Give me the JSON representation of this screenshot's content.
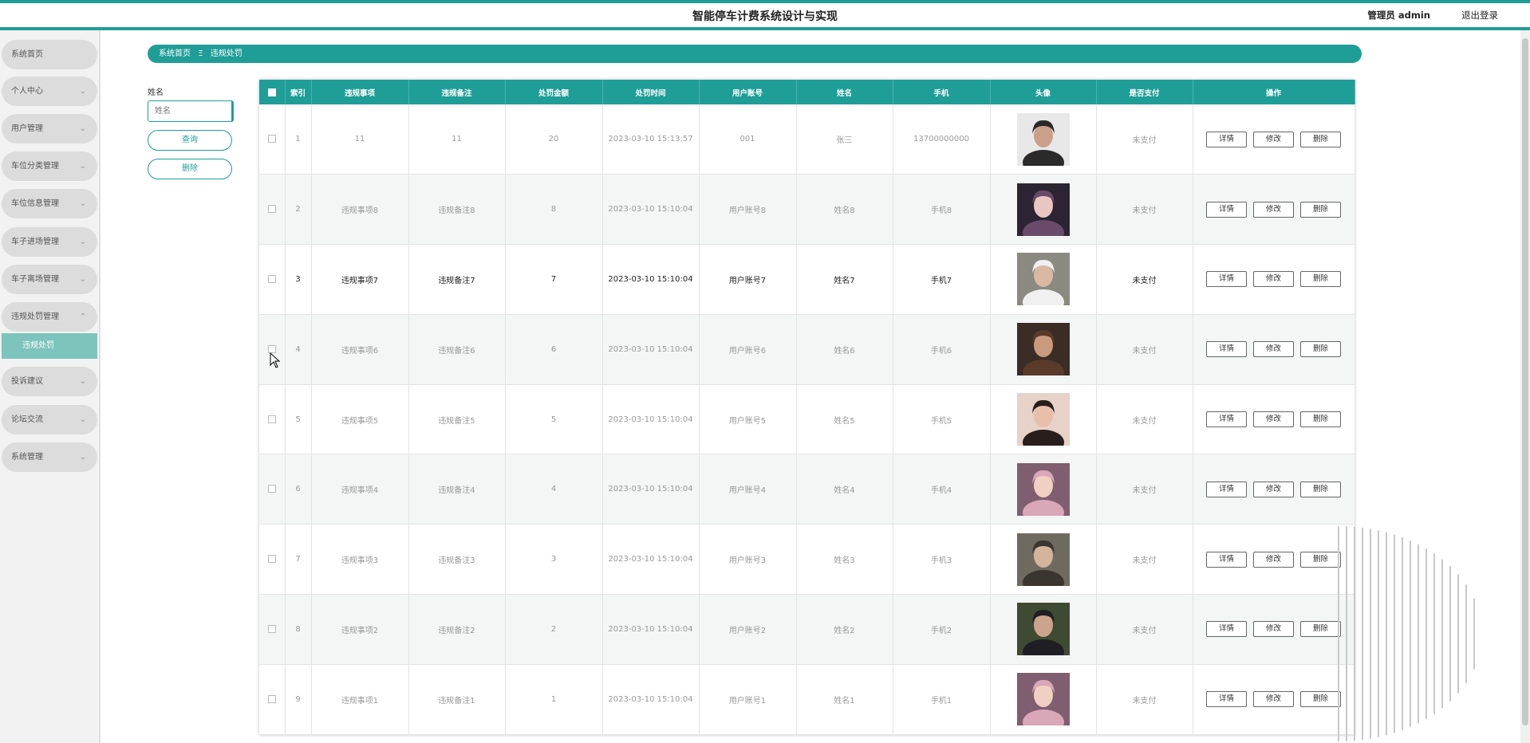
{
  "header": {
    "title": "智能停车计费系统设计与实现",
    "user": "管理员 admin",
    "logout": "退出登录"
  },
  "sidebar": {
    "items": [
      {
        "label": "系统首页"
      },
      {
        "label": "个人中心"
      },
      {
        "label": "用户管理"
      },
      {
        "label": "车位分类管理"
      },
      {
        "label": "车位信息管理"
      },
      {
        "label": "车子进场管理"
      },
      {
        "label": "车子离场管理"
      },
      {
        "label": "违规处罚管理"
      },
      {
        "label": "投诉建议"
      },
      {
        "label": "论坛交流"
      },
      {
        "label": "系统管理"
      }
    ],
    "active_sub": "违规处罚"
  },
  "breadcrumb": {
    "home": "系统首页",
    "sep": "Ξ",
    "current": "违规处罚"
  },
  "search": {
    "label": "姓名",
    "placeholder": "姓名",
    "query_button": "查询",
    "delete_button": "删除"
  },
  "table": {
    "headers": [
      "索引",
      "违规事项",
      "违规备注",
      "处罚金额",
      "处罚时间",
      "用户账号",
      "姓名",
      "手机",
      "头像",
      "是否支付",
      "操作"
    ],
    "rows": [
      {
        "index": "1",
        "item": "11",
        "note": "11",
        "amount": "20",
        "time": "2023-03-10 15:13:57",
        "account": "001",
        "name": "张三",
        "phone": "13700000000",
        "paid": "未支付"
      },
      {
        "index": "2",
        "item": "违规事项8",
        "note": "违规备注8",
        "amount": "8",
        "time": "2023-03-10 15:10:04",
        "account": "用户账号8",
        "name": "姓名8",
        "phone": "手机8",
        "paid": "未支付"
      },
      {
        "index": "3",
        "item": "违规事项7",
        "note": "违规备注7",
        "amount": "7",
        "time": "2023-03-10 15:10:04",
        "account": "用户账号7",
        "name": "姓名7",
        "phone": "手机7",
        "paid": "未支付"
      },
      {
        "index": "4",
        "item": "违规事项6",
        "note": "违规备注6",
        "amount": "6",
        "time": "2023-03-10 15:10:04",
        "account": "用户账号6",
        "name": "姓名6",
        "phone": "手机6",
        "paid": "未支付"
      },
      {
        "index": "5",
        "item": "违规事项5",
        "note": "违规备注5",
        "amount": "5",
        "time": "2023-03-10 15:10:04",
        "account": "用户账号5",
        "name": "姓名5",
        "phone": "手机5",
        "paid": "未支付"
      },
      {
        "index": "6",
        "item": "违规事项4",
        "note": "违规备注4",
        "amount": "4",
        "time": "2023-03-10 15:10:04",
        "account": "用户账号4",
        "name": "姓名4",
        "phone": "手机4",
        "paid": "未支付"
      },
      {
        "index": "7",
        "item": "违规事项3",
        "note": "违规备注3",
        "amount": "3",
        "time": "2023-03-10 15:10:04",
        "account": "用户账号3",
        "name": "姓名3",
        "phone": "手机3",
        "paid": "未支付"
      },
      {
        "index": "8",
        "item": "违规事项2",
        "note": "违规备注2",
        "amount": "2",
        "time": "2023-03-10 15:10:04",
        "account": "用户账号2",
        "name": "姓名2",
        "phone": "手机2",
        "paid": "未支付"
      },
      {
        "index": "9",
        "item": "违规事项1",
        "note": "违规备注1",
        "amount": "1",
        "time": "2023-03-10 15:10:04",
        "account": "用户账号1",
        "name": "姓名1",
        "phone": "手机1",
        "paid": "未支付"
      }
    ],
    "actions": {
      "detail": "详情",
      "edit": "修改",
      "delete": "删除"
    }
  },
  "colors": {
    "accent": "#1f9e97",
    "sub_menu": "#7dc4bd"
  }
}
